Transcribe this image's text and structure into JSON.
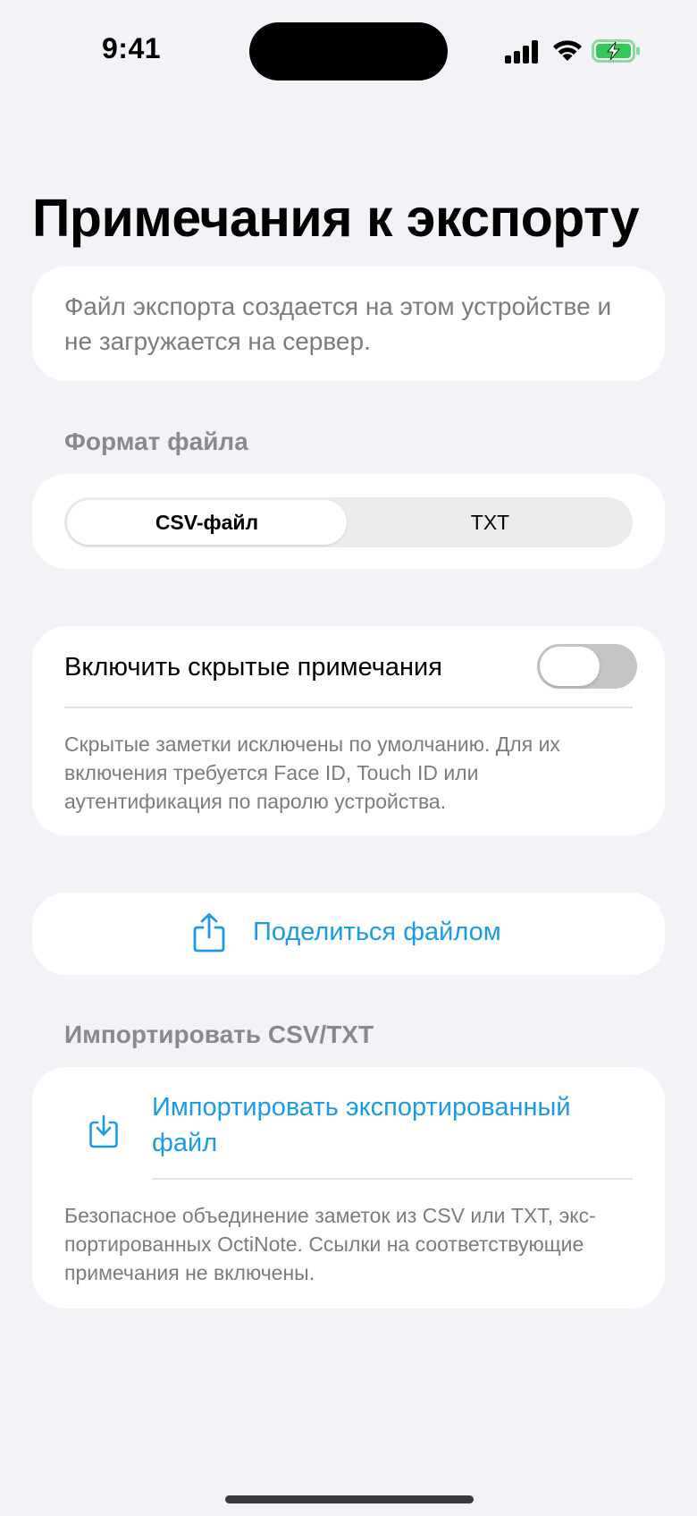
{
  "status_bar": {
    "time": "9:41",
    "icons": [
      "cellular-signal-icon",
      "wifi-icon",
      "battery-charging-icon"
    ],
    "battery_color": "#34c759"
  },
  "page": {
    "title": "Примечания к экспорту"
  },
  "info": {
    "text": "Файл экспорта создается на этом устройстве и не загружается на сервер."
  },
  "format": {
    "header": "Формат файла",
    "options": [
      "CSV-файл",
      "TXT"
    ],
    "selected": "CSV-файл"
  },
  "hidden_notes": {
    "label": "Включить скрытые примечания",
    "enabled": false,
    "note": "Скрытые заметки исключены по умолчанию. Для их включения требуется Face ID, Touch ID или аутентификация по паролю устройства."
  },
  "share": {
    "icon": "share-icon",
    "label": "Поделиться файлом"
  },
  "import": {
    "header": "Импортировать CSV/TXT",
    "icon": "import-icon",
    "label": "Импортировать экспортированный файл",
    "note": "Безопасное объединение заметок из CSV или TXT, экс­портированных OctiNote. Ссылки на соответствующие примечания не включены."
  },
  "colors": {
    "accent": "#1a9be6",
    "background": "#f2f2f7",
    "secondary_text": "#7c7c80"
  }
}
